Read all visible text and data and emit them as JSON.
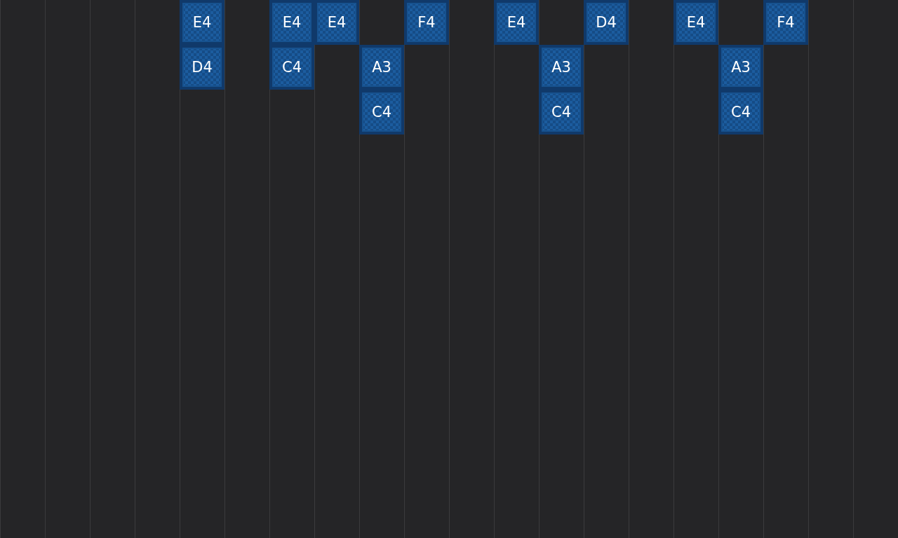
{
  "rows": [
    [
      {
        "kind": "empty"
      },
      {
        "kind": "empty"
      },
      {
        "kind": "empty"
      },
      {
        "kind": "empty"
      },
      {
        "kind": "note",
        "label": "E4"
      },
      {
        "kind": "empty"
      },
      {
        "kind": "note",
        "label": "E4"
      },
      {
        "kind": "note",
        "label": "E4"
      },
      {
        "kind": "empty"
      },
      {
        "kind": "note",
        "label": "F4"
      },
      {
        "kind": "empty"
      },
      {
        "kind": "note",
        "label": "E4"
      },
      {
        "kind": "empty"
      },
      {
        "kind": "note",
        "label": "D4"
      },
      {
        "kind": "empty"
      },
      {
        "kind": "note",
        "label": "E4"
      },
      {
        "kind": "empty"
      },
      {
        "kind": "note",
        "label": "F4"
      },
      {
        "kind": "empty"
      },
      {
        "kind": "empty"
      }
    ],
    [
      {
        "kind": "empty"
      },
      {
        "kind": "empty"
      },
      {
        "kind": "empty"
      },
      {
        "kind": "empty"
      },
      {
        "kind": "note",
        "label": "D4"
      },
      {
        "kind": "empty"
      },
      {
        "kind": "note",
        "label": "C4"
      },
      {
        "kind": "empty"
      },
      {
        "kind": "note",
        "label": "A3"
      },
      {
        "kind": "empty"
      },
      {
        "kind": "empty"
      },
      {
        "kind": "empty"
      },
      {
        "kind": "note",
        "label": "A3"
      },
      {
        "kind": "empty"
      },
      {
        "kind": "empty"
      },
      {
        "kind": "empty"
      },
      {
        "kind": "note",
        "label": "A3"
      },
      {
        "kind": "empty"
      },
      {
        "kind": "empty"
      },
      {
        "kind": "empty"
      }
    ],
    [
      {
        "kind": "empty"
      },
      {
        "kind": "empty"
      },
      {
        "kind": "empty"
      },
      {
        "kind": "empty"
      },
      {
        "kind": "empty"
      },
      {
        "kind": "empty"
      },
      {
        "kind": "empty"
      },
      {
        "kind": "empty"
      },
      {
        "kind": "note",
        "label": "C4"
      },
      {
        "kind": "empty"
      },
      {
        "kind": "empty"
      },
      {
        "kind": "empty"
      },
      {
        "kind": "note",
        "label": "C4"
      },
      {
        "kind": "empty"
      },
      {
        "kind": "empty"
      },
      {
        "kind": "empty"
      },
      {
        "kind": "note",
        "label": "C4"
      },
      {
        "kind": "empty"
      },
      {
        "kind": "empty"
      },
      {
        "kind": "empty"
      }
    ]
  ]
}
